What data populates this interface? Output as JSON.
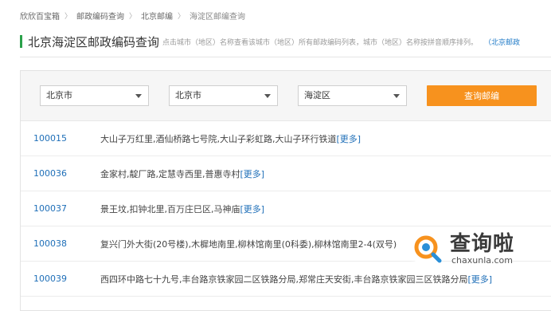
{
  "breadcrumb": {
    "items": [
      "欣欣百宝箱",
      "邮政编码查询",
      "北京邮编"
    ],
    "current": "海淀区邮编查询",
    "separator": "〉"
  },
  "header": {
    "title": "北京海淀区邮政编码查询",
    "description": "点击城市（地区）名称查看该城市（地区）所有邮政编码列表，城市（地区）名称按拼音顺序排列。",
    "link_text": "（北京邮政"
  },
  "filters": {
    "province": "北京市",
    "city": "北京市",
    "district": "海淀区",
    "query_button": "查询邮编"
  },
  "results": [
    {
      "code": "100015",
      "address": "大山子万红里,酒仙桥路七号院,大山子彩虹路,大山子环行铁道",
      "more": "[更多]"
    },
    {
      "code": "100036",
      "address": "金家村,靛厂路,定慧寺西里,普惠寺村",
      "more": "[更多]"
    },
    {
      "code": "100037",
      "address": "景王坟,扣钟北里,百万庄巳区,马神庙",
      "more": "[更多]"
    },
    {
      "code": "100038",
      "address": "复兴门外大街(20号楼),木樨地南里,柳林馆南里(0科委),柳林馆南里2-4(双号)",
      "more": ""
    },
    {
      "code": "100039",
      "address": "西四环中路七十九号,丰台路京铁家园二区铁路分局,郑常庄天安街,丰台路京铁家园三区铁路分局",
      "more": "[更多]"
    }
  ],
  "watermark": {
    "text": "查询啦",
    "domain": "chaxunla.com"
  },
  "colors": {
    "accent_orange": "#f7921e",
    "link_blue": "#1f6fb8",
    "title_bar_green": "#2aa14a"
  }
}
